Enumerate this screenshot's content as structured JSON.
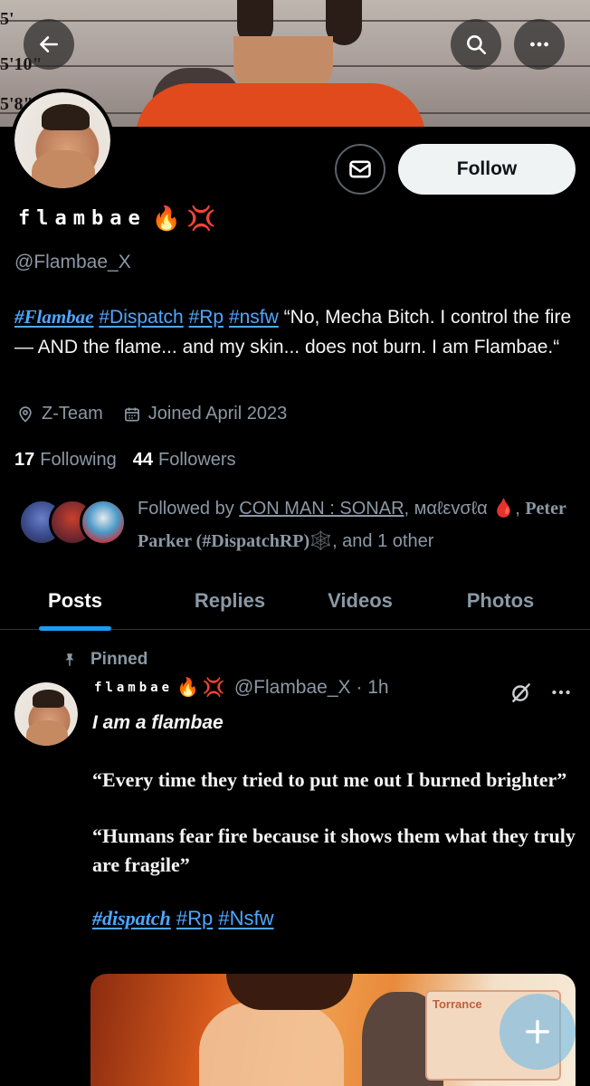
{
  "banner": {
    "height_marks": [
      "5'",
      "5'10\"",
      "5'8\""
    ]
  },
  "header": {
    "back_icon": "arrow-left-icon",
    "search_icon": "search-icon",
    "more_icon": "more-horizontal-icon"
  },
  "profile": {
    "display_name": "flambae",
    "name_emojis": [
      "🔥",
      "💢"
    ],
    "handle": "@Flambae_X",
    "follow_label": "Follow",
    "bio": {
      "tags": [
        "#Flambae",
        "#Dispatch",
        "#Rp",
        "#nsfw"
      ],
      "text": "“No, Mecha Bitch. I control the fire — AND the flame... and my skin... does not burn. I am Flambae.“"
    },
    "location": "Z-Team",
    "joined": "Joined April 2023",
    "following_count": "17",
    "following_label": "Following",
    "followers_count": "44",
    "followers_label": "Followers",
    "followed_by": {
      "prefix": "Followed by ",
      "user1": "CON MAN : SONAR",
      "user2": "мαℓεvσℓα 🩸",
      "user3": "Peter Parker (#DispatchRP)🕸️",
      "suffix": ", and 1 other"
    }
  },
  "tabs": [
    {
      "label": "Posts",
      "active": true
    },
    {
      "label": "Replies",
      "active": false
    },
    {
      "label": "Videos",
      "active": false
    },
    {
      "label": "Photos",
      "active": false
    }
  ],
  "post": {
    "pinned_label": "Pinned",
    "author_name": "flambae",
    "author_emojis": [
      "🔥",
      "💢"
    ],
    "handle_time": "@Flambae_X · 1h",
    "line1": "I am a flambae",
    "quote1": "“Every time they tried to put me out I burned brighter”",
    "quote2": "“Humans fear fire because it shows them what they truly are  fragile”",
    "tags": [
      "#dispatch",
      "#Rp",
      "#Nsfw"
    ],
    "media_card_text": "Torrance"
  },
  "fab": {
    "icon": "plus-icon"
  },
  "colors": {
    "accent": "#1d9bf0",
    "link": "#4ea7ff",
    "muted": "#8b98a5",
    "background": "#000000"
  }
}
